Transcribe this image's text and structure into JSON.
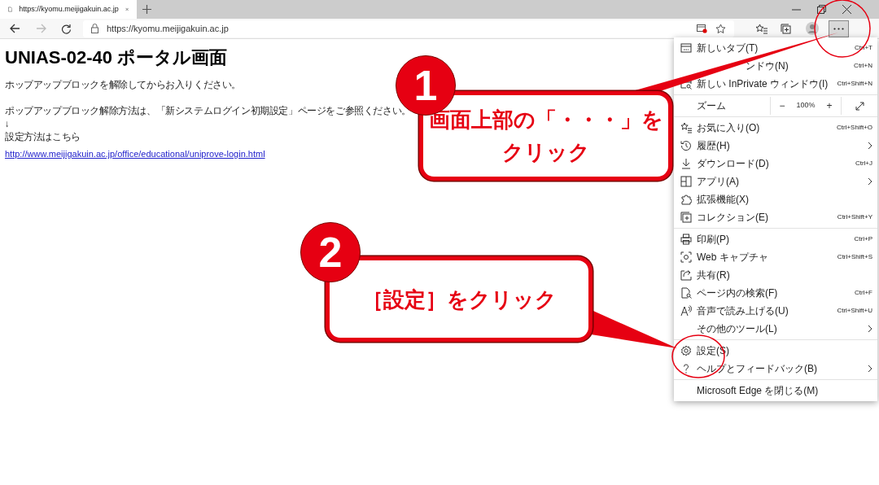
{
  "tab": {
    "title": "https://kyomu.meijigakuin.ac.jp"
  },
  "address_bar": {
    "url": "https://kyomu.meijigakuin.ac.jp"
  },
  "page": {
    "heading": "UNIAS-02-40 ポータル画面",
    "lines": [
      "ホップアップブロックを解除してからお入りください。",
      "ポップアップブロック解除方法は、「新システムログイン初期設定」ページをご参照ください。",
      "↓",
      "設定方法はこちら"
    ],
    "link": "http://www.meijigakuin.ac.jp/office/educational/uniprove-login.html"
  },
  "menu": {
    "groups": [
      [
        {
          "kind": "item",
          "label": "新しいタブ(T)",
          "shortcut": "Ctrl+T",
          "submenu": false,
          "partly_hidden": false
        },
        {
          "kind": "item",
          "label": "ンドウ(N)",
          "shortcut": "Ctrl+N",
          "submenu": false,
          "partly_hidden": true
        },
        {
          "kind": "item",
          "label": "新しい InPrivate ウィンドウ(I)",
          "shortcut": "Ctrl+Shift+N",
          "submenu": false,
          "partly_hidden": false
        }
      ],
      [
        {
          "kind": "zoom",
          "label": "ズーム",
          "minus": "−",
          "value": "100%",
          "plus": "+"
        }
      ],
      [
        {
          "kind": "item",
          "label": "お気に入り(O)",
          "shortcut": "Ctrl+Shift+O",
          "submenu": false,
          "partly_hidden": false
        },
        {
          "kind": "item",
          "label": "履歴(H)",
          "submenu": true,
          "partly_hidden": false
        },
        {
          "kind": "item",
          "label": "ダウンロード(D)",
          "shortcut": "Ctrl+J",
          "submenu": false,
          "partly_hidden": false
        },
        {
          "kind": "item",
          "label": "アプリ(A)",
          "submenu": true,
          "partly_hidden": false
        },
        {
          "kind": "item",
          "label": "拡張機能(X)",
          "submenu": false,
          "partly_hidden": false
        },
        {
          "kind": "item",
          "label": "コレクション(E)",
          "shortcut": "Ctrl+Shift+Y",
          "submenu": false,
          "partly_hidden": false
        }
      ],
      [
        {
          "kind": "item",
          "label": "印刷(P)",
          "shortcut": "Ctrl+P",
          "submenu": false,
          "partly_hidden": false
        },
        {
          "kind": "item",
          "label": "Web キャプチャ",
          "shortcut": "Ctrl+Shift+S",
          "submenu": false,
          "partly_hidden": false
        },
        {
          "kind": "item",
          "label": "共有(R)",
          "submenu": false,
          "partly_hidden": false
        },
        {
          "kind": "item",
          "label": "ページ内の検索(F)",
          "shortcut": "Ctrl+F",
          "submenu": false,
          "partly_hidden": false
        },
        {
          "kind": "item",
          "label": "音声で読み上げる(U)",
          "shortcut": "Ctrl+Shift+U",
          "submenu": false,
          "partly_hidden": false
        },
        {
          "kind": "item",
          "label": "その他のツール(L)",
          "submenu": true,
          "partly_hidden": false
        }
      ],
      [
        {
          "kind": "item",
          "label": "設定(S)",
          "submenu": false,
          "partly_hidden": false
        },
        {
          "kind": "item",
          "label": "ヘルプとフィードバック(B)",
          "submenu": true,
          "partly_hidden": false
        }
      ],
      [
        {
          "kind": "item",
          "label": "Microsoft Edge を閉じる(M)",
          "submenu": false,
          "partly_hidden": false
        }
      ]
    ]
  },
  "callouts": [
    {
      "number": "1",
      "lines": [
        "画面上部の「・・・」を",
        "クリック"
      ]
    },
    {
      "number": "2",
      "lines": [
        "［設定］をクリック"
      ]
    }
  ]
}
